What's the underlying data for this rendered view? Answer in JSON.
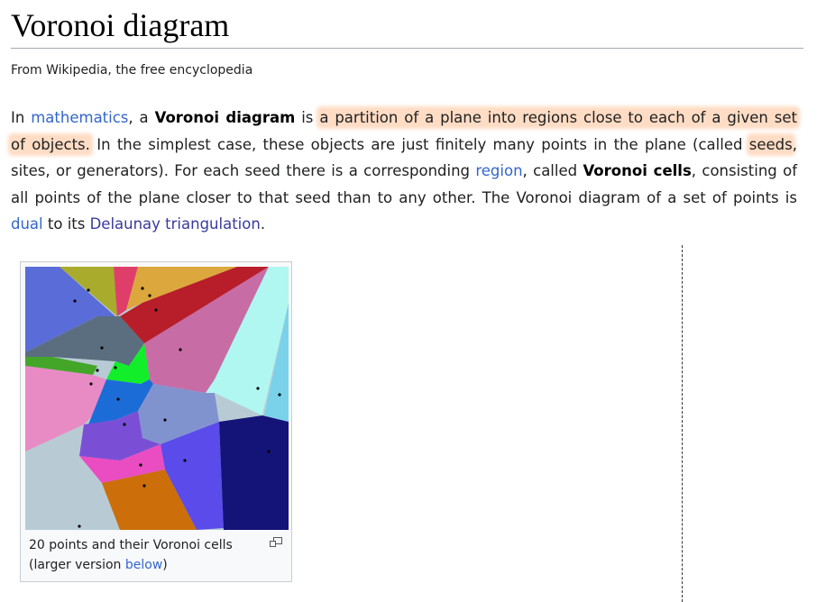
{
  "title": "Voronoi diagram",
  "tagline": "From Wikipedia, the free encyclopedia",
  "intro": {
    "t_in": "In ",
    "link_mathematics": "mathematics",
    "t_comma_a": ", a ",
    "bold_voronoi_diagram": "Voronoi diagram",
    "t_is": " is ",
    "hl_partition_1": "a partition of a plane into regions close to each of a given set",
    "hl_partition_2": "of objects.",
    "t_simplest": " In the simplest case, these objects are just finitely many points in the plane (called ",
    "hl_seeds": "seeds",
    "t_comma": ",",
    "t_sites": "sites, or generators). For each seed there is a corresponding ",
    "link_region": "region",
    "t_called": ", called ",
    "bold_voronoi_cells": "Voronoi cells",
    "t_consisting": ", consisting of",
    "t_all_points": "all points of the plane closer to that seed than to any other. The Voronoi diagram of a set of points is",
    "link_dual": "dual",
    "t_to_its": " to its ",
    "link_delaunay": "Delaunay triangulation",
    "t_period": "."
  },
  "figure": {
    "caption_line1": "20 points and their Voronoi cells",
    "caption_prefix": "(larger version ",
    "caption_link": "below",
    "caption_suffix": ")",
    "magnify_icon": "magnify-clip-icon"
  },
  "colors": {
    "link": "#3366cc",
    "link_visited": "#3a3a9e",
    "highlight": "#ffdcc4",
    "text": "#202122"
  }
}
